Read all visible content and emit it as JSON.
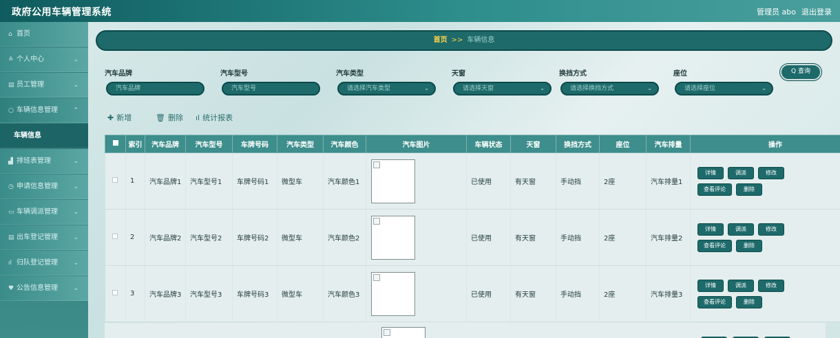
{
  "header": {
    "title": "政府公用车辆管理系统",
    "user": "管理员 abo",
    "logout": "退出登录"
  },
  "sidebar": {
    "items": [
      {
        "icon": "home-icon",
        "glyph": "⌂",
        "label": "首页",
        "chevron": ""
      },
      {
        "icon": "user-icon",
        "glyph": "≗",
        "label": "个人中心",
        "chevron": "⌄"
      },
      {
        "icon": "staff-icon",
        "glyph": "▤",
        "label": "员工管理",
        "chevron": "⌄"
      },
      {
        "icon": "car-icon",
        "glyph": "○",
        "label": "车辆信息管理",
        "chevron": "⌃"
      },
      {
        "icon": "",
        "glyph": "",
        "label": "车辆信息",
        "chevron": ""
      },
      {
        "icon": "chart-icon",
        "glyph": "▟",
        "label": "排班表管理",
        "chevron": "⌄"
      },
      {
        "icon": "clock-icon",
        "glyph": "◷",
        "label": "申请信息管理",
        "chevron": "⌄"
      },
      {
        "icon": "dispatch-icon",
        "glyph": "▭",
        "label": "车辆调派管理",
        "chevron": "⌄"
      },
      {
        "icon": "register-icon",
        "glyph": "▤",
        "label": "出车登记管理",
        "chevron": "⌄"
      },
      {
        "icon": "bar-icon",
        "glyph": "ıl",
        "label": "归队登记管理",
        "chevron": "⌄"
      },
      {
        "icon": "notice-icon",
        "glyph": "♥",
        "label": "公告信息管理",
        "chevron": "⌄"
      }
    ]
  },
  "breadcrumb": {
    "home": "首页",
    "sep": ">>",
    "current": "车辆信息"
  },
  "filters": [
    {
      "label": "汽车品牌",
      "placeholder": "汽车品牌"
    },
    {
      "label": "汽车型号",
      "placeholder": "汽车型号"
    },
    {
      "label": "汽车类型",
      "placeholder": "请选择汽车类型"
    },
    {
      "label": "天窗",
      "placeholder": "请选择天窗"
    },
    {
      "label": "换挡方式",
      "placeholder": "请选择换挡方式"
    },
    {
      "label": "座位",
      "placeholder": "请选择座位"
    }
  ],
  "query_button": "Q 查询",
  "actions": {
    "add": "新增",
    "delete": "删除",
    "report": "统计报表"
  },
  "table": {
    "columns": [
      "索引",
      "汽车品牌",
      "汽车型号",
      "车牌号码",
      "汽车类型",
      "汽车颜色",
      "汽车图片",
      "车辆状态",
      "天窗",
      "换挡方式",
      "座位",
      "汽车排量",
      "操作"
    ],
    "rows": [
      [
        "1",
        "汽车品牌1",
        "汽车型号1",
        "车牌号码1",
        "微型车",
        "汽车颜色1",
        "已使用",
        "有天窗",
        "手动挡",
        "2座",
        "汽车排量1"
      ],
      [
        "2",
        "汽车品牌2",
        "汽车型号2",
        "车牌号码2",
        "微型车",
        "汽车颜色2",
        "已使用",
        "有天窗",
        "手动挡",
        "2座",
        "汽车排量2"
      ],
      [
        "3",
        "汽车品牌3",
        "汽车型号3",
        "车牌号码3",
        "微型车",
        "汽车颜色3",
        "已使用",
        "有天窗",
        "手动挡",
        "2座",
        "汽车排量3"
      ]
    ],
    "ops": [
      "详情",
      "调派",
      "修改",
      "查看评论",
      "删除"
    ]
  }
}
